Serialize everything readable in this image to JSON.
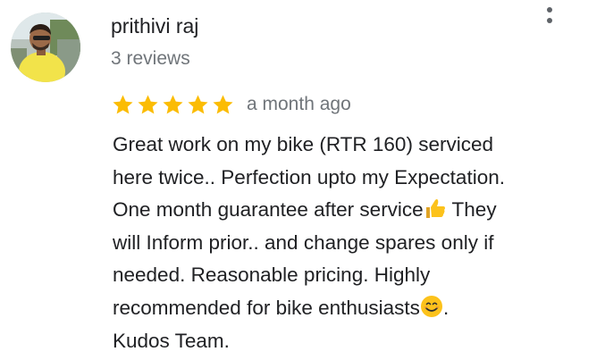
{
  "review": {
    "author_name": "prithivi raj",
    "review_count": "3 reviews",
    "rating": 5,
    "rating_max": 5,
    "time": "a month ago",
    "star_color": "#fbbc04",
    "text_lines": [
      {
        "text": "Great work on my bike (RTR 160) serviced",
        "after": ""
      },
      {
        "text": "here twice.. Perfection upto my Expectation.",
        "after": ""
      },
      {
        "text": "One month guarantee after service",
        "after": " They",
        "emoji": "thumbs-up-emoji"
      },
      {
        "text": "will Inform prior.. and change spares only if",
        "after": ""
      },
      {
        "text": "needed. Reasonable pricing. Highly",
        "after": ""
      },
      {
        "text": "recommended for bike enthusiasts",
        "after": ".",
        "emoji": "smiling-face-emoji"
      },
      {
        "text": "Kudos Team.",
        "after": ""
      }
    ]
  },
  "icons": {
    "more": "more-vert-icon",
    "avatar": "profile-photo"
  }
}
